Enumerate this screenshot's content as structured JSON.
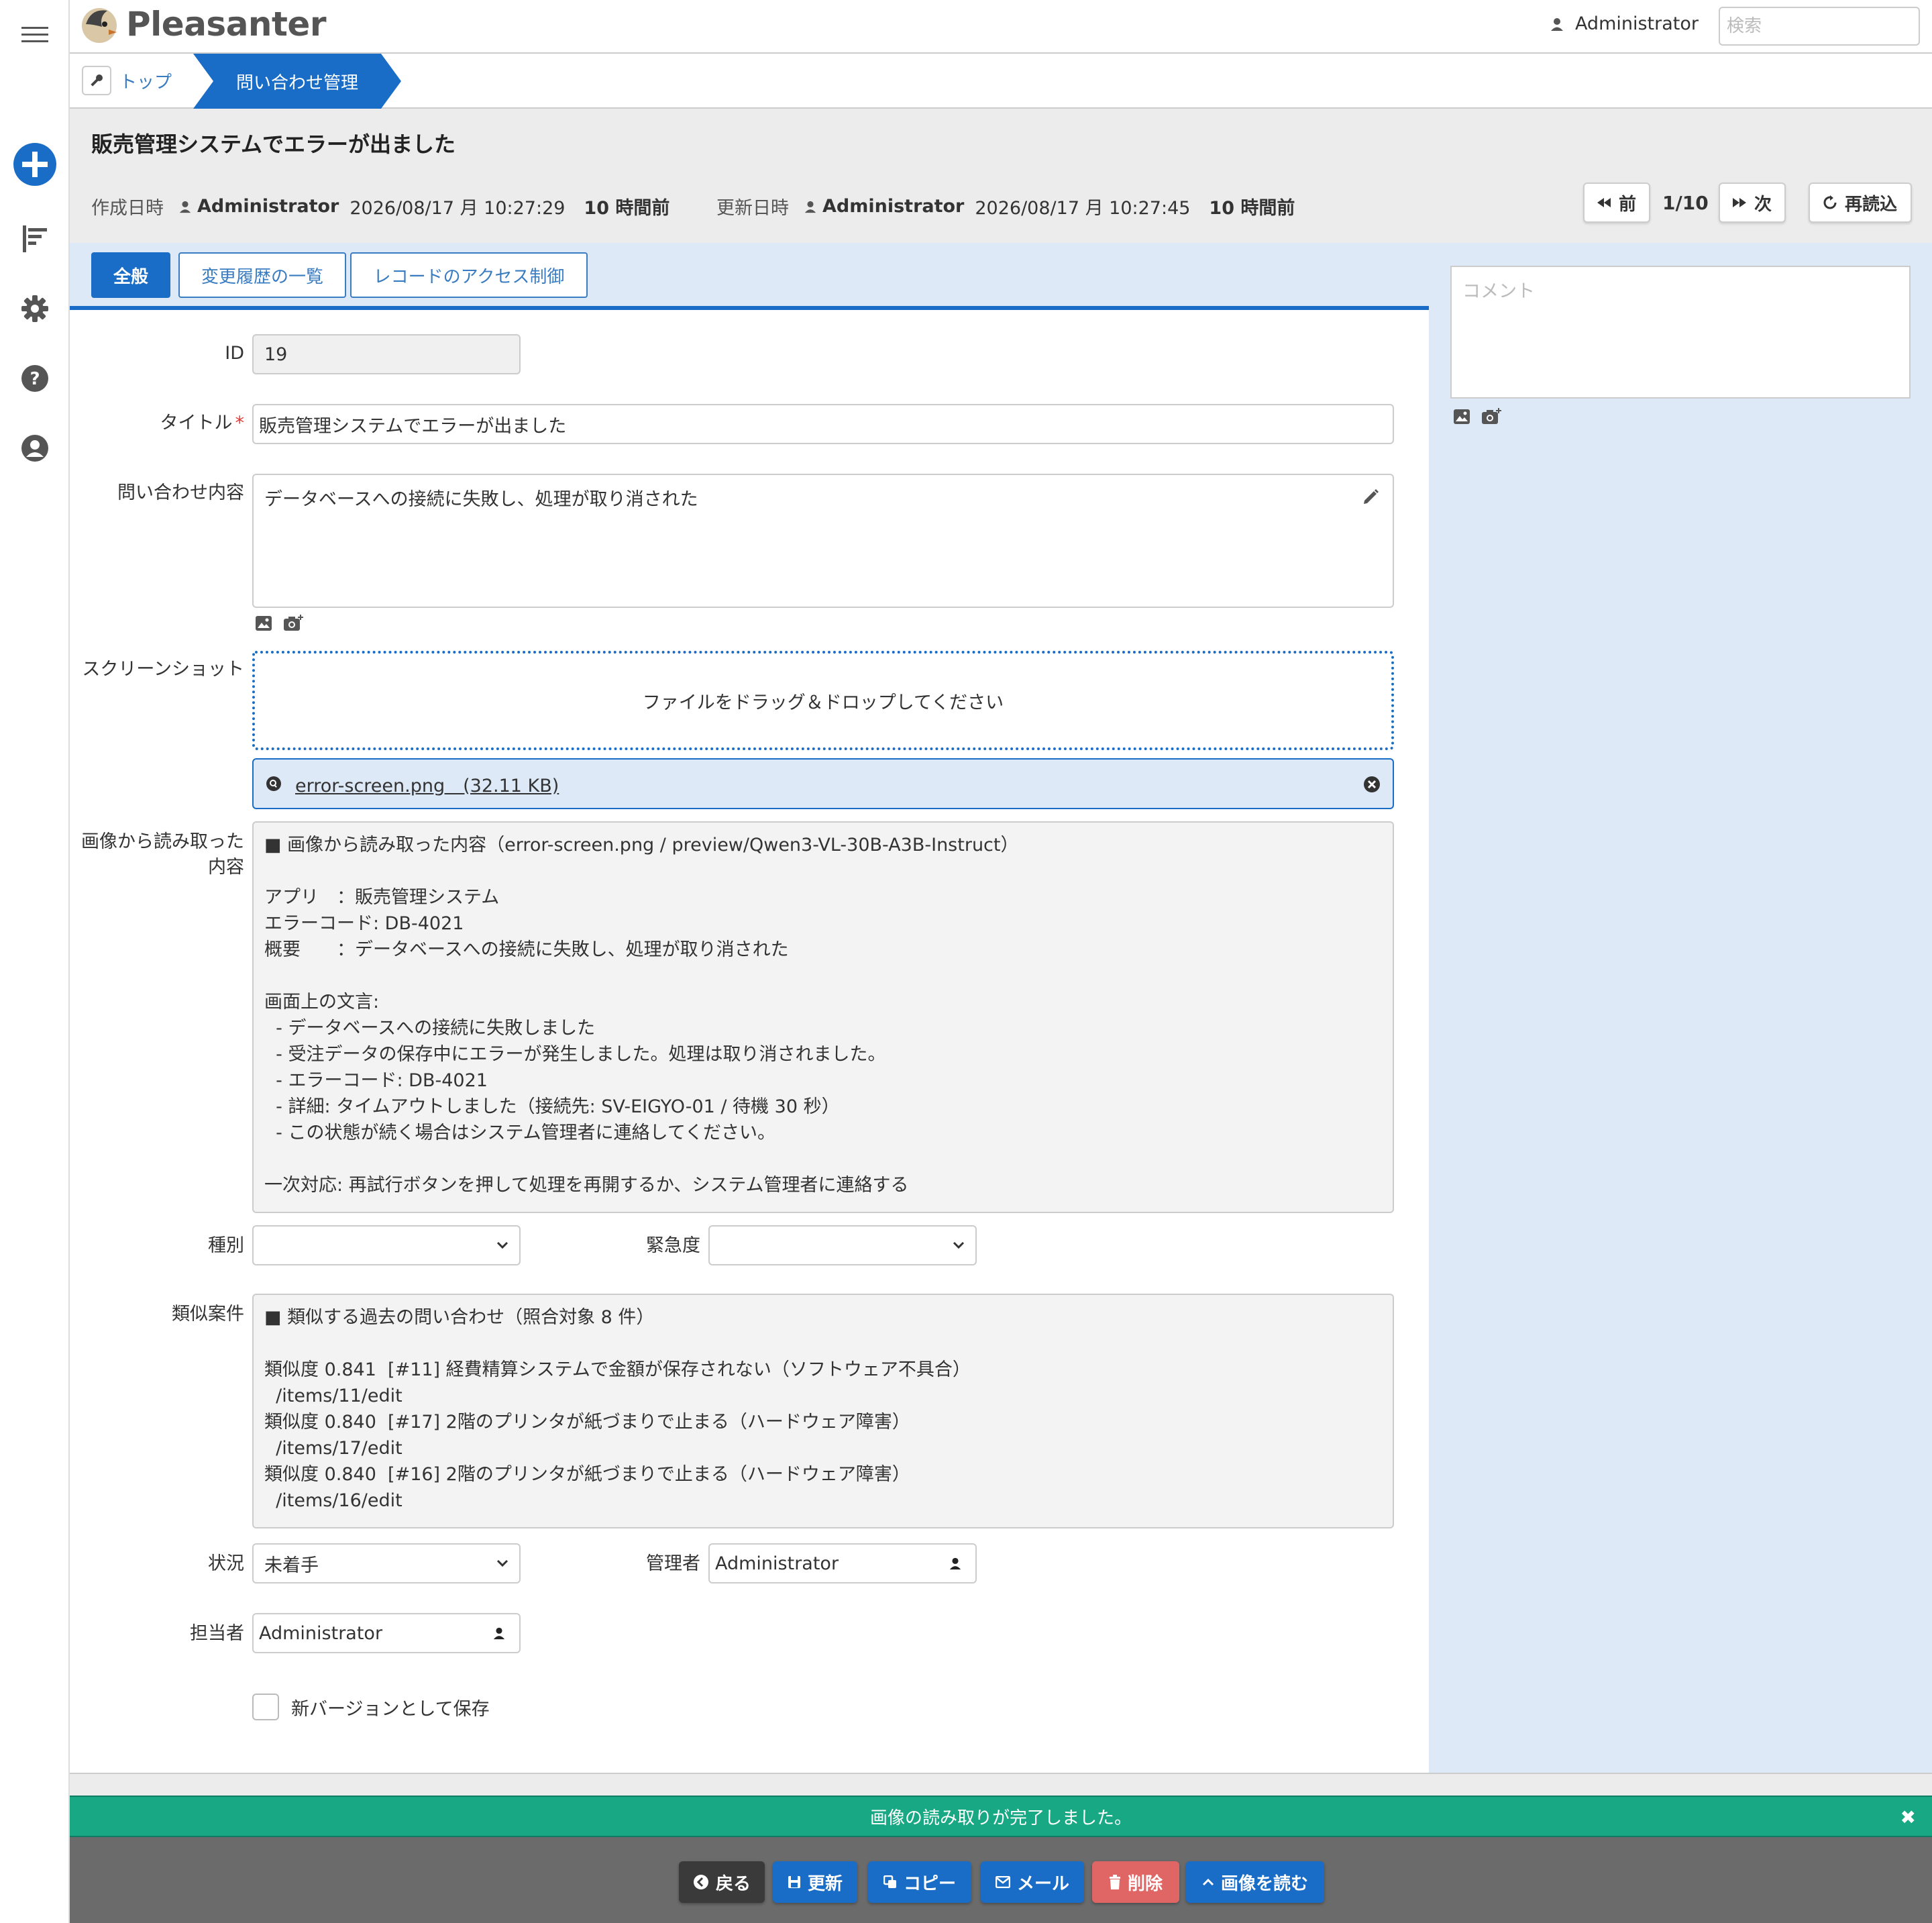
{
  "header": {
    "brand": "Pleasanter",
    "user": "Administrator",
    "search_placeholder": "検索"
  },
  "breadcrumb": {
    "top": "トップ",
    "current": "問い合わせ管理"
  },
  "record": {
    "title": "販売管理システムでエラーが出ました",
    "created_label": "作成日時",
    "created_by": "Administrator",
    "created_at": "2026/08/17 月 10:27:29",
    "created_ago": "10 時間前",
    "updated_label": "更新日時",
    "updated_by": "Administrator",
    "updated_at": "2026/08/17 月 10:27:45",
    "updated_ago": "10 時間前"
  },
  "pager": {
    "prev": "前",
    "counter": "1/10",
    "next": "次",
    "reload": "再読込"
  },
  "tabs": [
    "全般",
    "変更履歴の一覧",
    "レコードのアクセス制御"
  ],
  "comment_placeholder": "コメント",
  "form": {
    "id_label": "ID",
    "id_value": "19",
    "title_label": "タイトル",
    "required_mark": "*",
    "title_value": "販売管理システムでエラーが出ました",
    "content_label": "問い合わせ内容",
    "content_value": "データベースへの接続に失敗し、処理が取り消された",
    "screenshot_label": "スクリーンショット",
    "dropzone_text": "ファイルをドラッグ＆ドロップしてください",
    "file_name": "error-screen.png　(32.11 KB)",
    "ocr_label": "画像から読み取った内容",
    "ocr_lines": [
      "■ 画像から読み取った内容（error-screen.png / preview/Qwen3-VL-30B-A3B-Instruct）",
      "",
      "アプリ　：販売管理システム",
      "エラーコード: DB-4021",
      "概要　　：データベースへの接続に失敗し、処理が取り消された",
      "",
      "画面上の文言:",
      "  - データベースへの接続に失敗しました",
      "  - 受注データの保存中にエラーが発生しました。処理は取り消されました。",
      "  - エラーコード: DB-4021",
      "  - 詳細: タイムアウトしました（接続先: SV-EIGYO-01 / 待機 30 秒）",
      "  - この状態が続く場合はシステム管理者に連絡してください。",
      "",
      "一次対応: 再試行ボタンを押して処理を再開するか、システム管理者に連絡する"
    ],
    "type_label": "種別",
    "type_value": "",
    "urgency_label": "緊急度",
    "urgency_value": "",
    "similar_label": "類似案件",
    "similar_lines": [
      "■ 類似する過去の問い合わせ（照合対象 8 件）",
      "",
      "類似度 0.841  [#11] 経費精算システムで金額が保存されない（ソフトウェア不具合）",
      "  /items/11/edit",
      "類似度 0.840  [#17] 2階のプリンタが紙づまりで止まる（ハードウェア障害）",
      "  /items/17/edit",
      "類似度 0.840  [#16] 2階のプリンタが紙づまりで止まる（ハードウェア障害）",
      "  /items/16/edit"
    ],
    "status_label": "状況",
    "status_value": "未着手",
    "manager_label": "管理者",
    "manager_value": "Administrator",
    "owner_label": "担当者",
    "owner_value": "Administrator",
    "save_version": "新バージョンとして保存"
  },
  "message": "画像の読み取りが完了しました。",
  "footer": {
    "back": "戻る",
    "update": "更新",
    "copy": "コピー",
    "mail": "メール",
    "delete": "削除",
    "read_image": "画像を読む"
  },
  "colors": {
    "accent": "#1a6dc6",
    "success": "#18a884",
    "danger": "#e06666",
    "footer_bg": "#6b6b6b"
  }
}
